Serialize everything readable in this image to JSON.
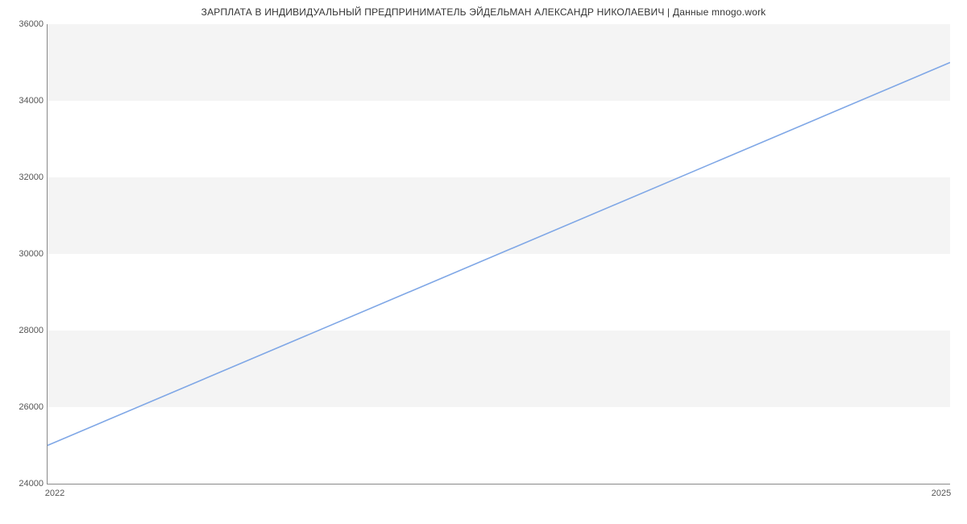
{
  "chart_data": {
    "type": "line",
    "title": "ЗАРПЛАТА В ИНДИВИДУАЛЬНЫЙ ПРЕДПРИНИМАТЕЛЬ ЭЙДЕЛЬМАН АЛЕКСАНДР НИКОЛАЕВИЧ | Данные mnogo.work",
    "xlabel": "",
    "ylabel": "",
    "x": [
      2022,
      2025
    ],
    "values": [
      25000,
      35000
    ],
    "x_ticks": [
      2022,
      2025
    ],
    "y_ticks": [
      24000,
      26000,
      28000,
      30000,
      32000,
      34000,
      36000
    ],
    "ylim": [
      24000,
      36000
    ],
    "xlim": [
      2022,
      2025
    ],
    "line_color": "#7fa7e6",
    "band_color": "#f4f4f4"
  }
}
